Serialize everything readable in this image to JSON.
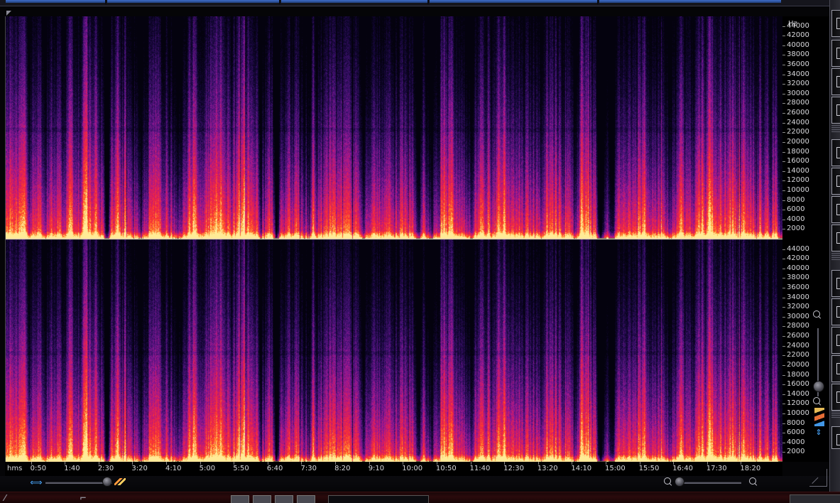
{
  "spectrogram": {
    "frequency_unit": "Hz",
    "time_unit": "hms",
    "channel_top_freq_ticks": [
      "44000",
      "42000",
      "40000",
      "38000",
      "36000",
      "34000",
      "32000",
      "30000",
      "28000",
      "26000",
      "24000",
      "22000",
      "20000",
      "18000",
      "16000",
      "14000",
      "12000",
      "10000",
      "8000",
      "6000",
      "4000",
      "2000"
    ],
    "channel_bottom_freq_ticks": [
      "44000",
      "42000",
      "40000",
      "38000",
      "36000",
      "34000",
      "32000",
      "30000",
      "28000",
      "26000",
      "24000",
      "22000",
      "20000",
      "18000",
      "16000",
      "14000",
      "12000",
      "10000",
      "8000",
      "6000",
      "4000",
      "2000"
    ],
    "time_ticks": [
      "0:50",
      "1:40",
      "2:30",
      "3:20",
      "4:10",
      "5:00",
      "5:50",
      "6:40",
      "7:30",
      "8:20",
      "9:10",
      "10:00",
      "10:50",
      "11:40",
      "12:30",
      "13:20",
      "14:10",
      "15:00",
      "15:50",
      "16:40",
      "17:30",
      "18:20"
    ],
    "frequency_max_hz": 46000,
    "duration_seconds": 1150,
    "track_boundaries_seconds": [
      150,
      400,
      610,
      880
    ]
  },
  "colors": {
    "low": "#0a0620",
    "mid": "#7a1a8a",
    "high": "#ff2a3a",
    "peak": "#ffd060",
    "accent": "#4aa8ff"
  },
  "icons": {
    "horizontal_fit": "zoom-fit-horizontal-icon",
    "colormap": "colormap-icon",
    "zoom_in": "zoom-in-icon",
    "zoom_out": "zoom-out-icon",
    "vertical_fit": "zoom-fit-vertical-icon"
  }
}
